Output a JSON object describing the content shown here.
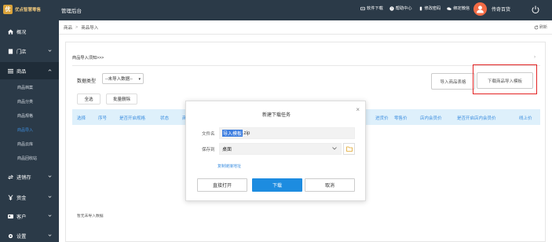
{
  "topbar": {
    "brand": "优点智慧零售",
    "title": "管理后台",
    "actions": [
      {
        "label": "软件下载",
        "icon": "download-icon"
      },
      {
        "label": "帮助中心",
        "icon": "help-icon"
      },
      {
        "label": "修改密码",
        "icon": "lock-icon"
      },
      {
        "label": "绑定微信",
        "icon": "wechat-icon"
      }
    ],
    "user_name": "传奇百货"
  },
  "sidebar": {
    "menus": [
      {
        "label": "概况",
        "icon": "home-icon"
      },
      {
        "label": "门店",
        "icon": "store-icon"
      },
      {
        "label": "商品",
        "icon": "list-icon"
      },
      {
        "label": "进销存",
        "icon": "exchange-icon"
      },
      {
        "label": "资金",
        "icon": "yen-icon"
      },
      {
        "label": "客户",
        "icon": "customer-icon"
      },
      {
        "label": "设置",
        "icon": "gear-icon"
      }
    ],
    "submenu": [
      "商品档案",
      "商品分类",
      "商品规格",
      "商品导入",
      "商品云库",
      "商品回收站"
    ]
  },
  "breadcrumb": {
    "root": "商品",
    "current": "商品导入",
    "refresh": "刷新"
  },
  "content": {
    "notice": "商品导入须知>>>",
    "type_label": "数据类型",
    "type_value": "--未导入数据--",
    "import_button": "导入商品表格",
    "download_template_button": "下载商品导入模板",
    "select_all": "全选",
    "batch_delete": "批量删除",
    "columns": [
      "选择",
      "序号",
      "是否开启规格",
      "状态",
      "商",
      "进货价",
      "零售价",
      "店内会员价",
      "是否开启店内会员价",
      "线上价"
    ],
    "empty_text": "暂无未导入数据"
  },
  "dialog": {
    "title": "新建下载任务",
    "filename_label": "文件名",
    "filename_selected": "导入模板",
    "filename_ext": ".zip",
    "savepath_label": "保存到",
    "savepath_value": "桌面",
    "copy_link": "复制链接地址",
    "open_button": "直接打开",
    "download_button": "下载",
    "cancel_button": "取消"
  },
  "colors": {
    "sidebar": "#2b3a48",
    "accent": "#1d8ce0",
    "highlight": "#e32323",
    "table_header": "#def0fb"
  }
}
